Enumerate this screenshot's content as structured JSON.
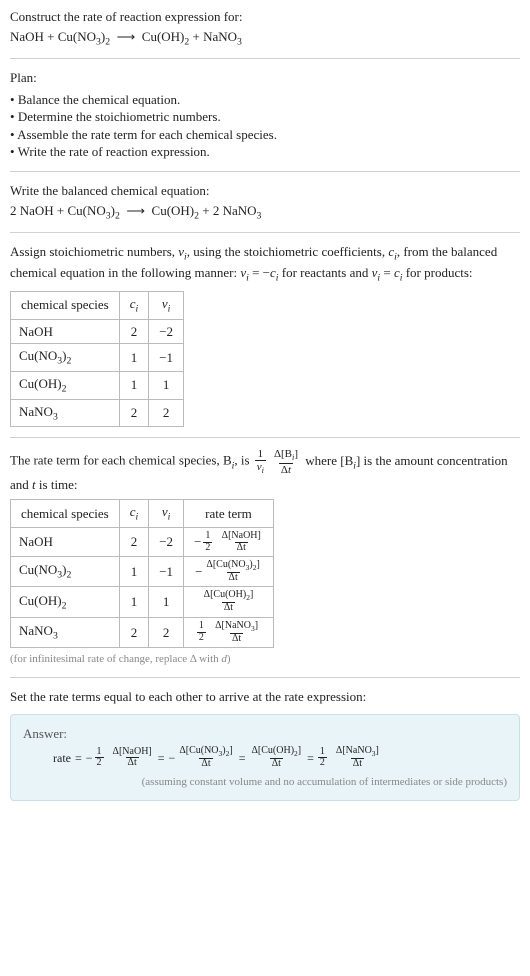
{
  "prompt": {
    "line1": "Construct the rate of reaction expression for:",
    "equation_html": "NaOH + Cu(NO<sub>3</sub>)<sub>2</sub>&nbsp; ⟶ &nbsp;Cu(OH)<sub>2</sub> + NaNO<sub>3</sub>"
  },
  "plan": {
    "heading": "Plan:",
    "items": [
      "Balance the chemical equation.",
      "Determine the stoichiometric numbers.",
      "Assemble the rate term for each chemical species.",
      "Write the rate of reaction expression."
    ]
  },
  "balanced": {
    "heading": "Write the balanced chemical equation:",
    "equation_html": "2 NaOH + Cu(NO<sub>3</sub>)<sub>2</sub>&nbsp; ⟶ &nbsp;Cu(OH)<sub>2</sub> + 2 NaNO<sub>3</sub>"
  },
  "assign": {
    "text_html": "Assign stoichiometric numbers, <span class=\"ivar\">ν<sub>i</sub></span>, using the stoichiometric coefficients, <span class=\"ivar\">c<sub>i</sub></span>, from the balanced chemical equation in the following manner: <span class=\"ivar\">ν<sub>i</sub></span> = −<span class=\"ivar\">c<sub>i</sub></span> for reactants and <span class=\"ivar\">ν<sub>i</sub></span> = <span class=\"ivar\">c<sub>i</sub></span> for products:"
  },
  "table1": {
    "headers": {
      "species": "chemical species",
      "ci_html": "<span class=\"ivar\">c<sub>i</sub></span>",
      "vi_html": "<span class=\"ivar\">ν<sub>i</sub></span>"
    },
    "rows": [
      {
        "species_html": "NaOH",
        "ci": "2",
        "vi": "−2"
      },
      {
        "species_html": "Cu(NO<sub>3</sub>)<sub>2</sub>",
        "ci": "1",
        "vi": "−1"
      },
      {
        "species_html": "Cu(OH)<sub>2</sub>",
        "ci": "1",
        "vi": "1"
      },
      {
        "species_html": "NaNO<sub>3</sub>",
        "ci": "2",
        "vi": "2"
      }
    ]
  },
  "rate_term_intro": {
    "text_pre": "The rate term for each chemical species, B",
    "text_mid": ", is ",
    "frac_left_num": "1",
    "frac_left_den_html": "<span class=\"ivar\">ν<sub>i</sub></span>",
    "frac_right_num_html": "Δ[B<sub><i>i</i></sub>]",
    "frac_right_den_html": "Δ<span class=\"ivar\">t</span>",
    "text_after_html": " where [B<sub><i>i</i></sub>] is the amount concentration and <span class=\"ivar\">t</span> is time:"
  },
  "table2": {
    "headers": {
      "species": "chemical species",
      "ci_html": "<span class=\"ivar\">c<sub>i</sub></span>",
      "vi_html": "<span class=\"ivar\">ν<sub>i</sub></span>",
      "rate": "rate term"
    },
    "rows": [
      {
        "species_html": "NaOH",
        "ci": "2",
        "vi": "−2",
        "neg": "−",
        "coef_num": "1",
        "coef_den": "2",
        "dnum": "Δ[NaOH]",
        "dden": "Δt"
      },
      {
        "species_html": "Cu(NO<sub>3</sub>)<sub>2</sub>",
        "ci": "1",
        "vi": "−1",
        "neg": "−",
        "coef_num": "",
        "coef_den": "",
        "dnum": "Δ[Cu(NO<sub>3</sub>)<sub>2</sub>]",
        "dden": "Δt"
      },
      {
        "species_html": "Cu(OH)<sub>2</sub>",
        "ci": "1",
        "vi": "1",
        "neg": "",
        "coef_num": "",
        "coef_den": "",
        "dnum": "Δ[Cu(OH)<sub>2</sub>]",
        "dden": "Δt"
      },
      {
        "species_html": "NaNO<sub>3</sub>",
        "ci": "2",
        "vi": "2",
        "neg": "",
        "coef_num": "1",
        "coef_den": "2",
        "dnum": "Δ[NaNO<sub>3</sub>]",
        "dden": "Δt"
      }
    ]
  },
  "infinitesimal_caption_html": "(for infinitesimal rate of change, replace Δ with <span class=\"ivar\">d</span>)",
  "final": {
    "heading": "Set the rate terms equal to each other to arrive at the rate expression:",
    "answer_label": "Answer:",
    "rate_label": "rate",
    "eq": "=",
    "terms": [
      {
        "neg": "−",
        "coef_num": "1",
        "coef_den": "2",
        "dnum": "Δ[NaOH]",
        "dden": "Δt"
      },
      {
        "neg": "−",
        "coef_num": "",
        "coef_den": "",
        "dnum": "Δ[Cu(NO<sub>3</sub>)<sub>2</sub>]",
        "dden": "Δt"
      },
      {
        "neg": "",
        "coef_num": "",
        "coef_den": "",
        "dnum": "Δ[Cu(OH)<sub>2</sub>]",
        "dden": "Δt"
      },
      {
        "neg": "",
        "coef_num": "1",
        "coef_den": "2",
        "dnum": "Δ[NaNO<sub>3</sub>]",
        "dden": "Δt"
      }
    ],
    "note": "(assuming constant volume and no accumulation of intermediates or side products)"
  }
}
